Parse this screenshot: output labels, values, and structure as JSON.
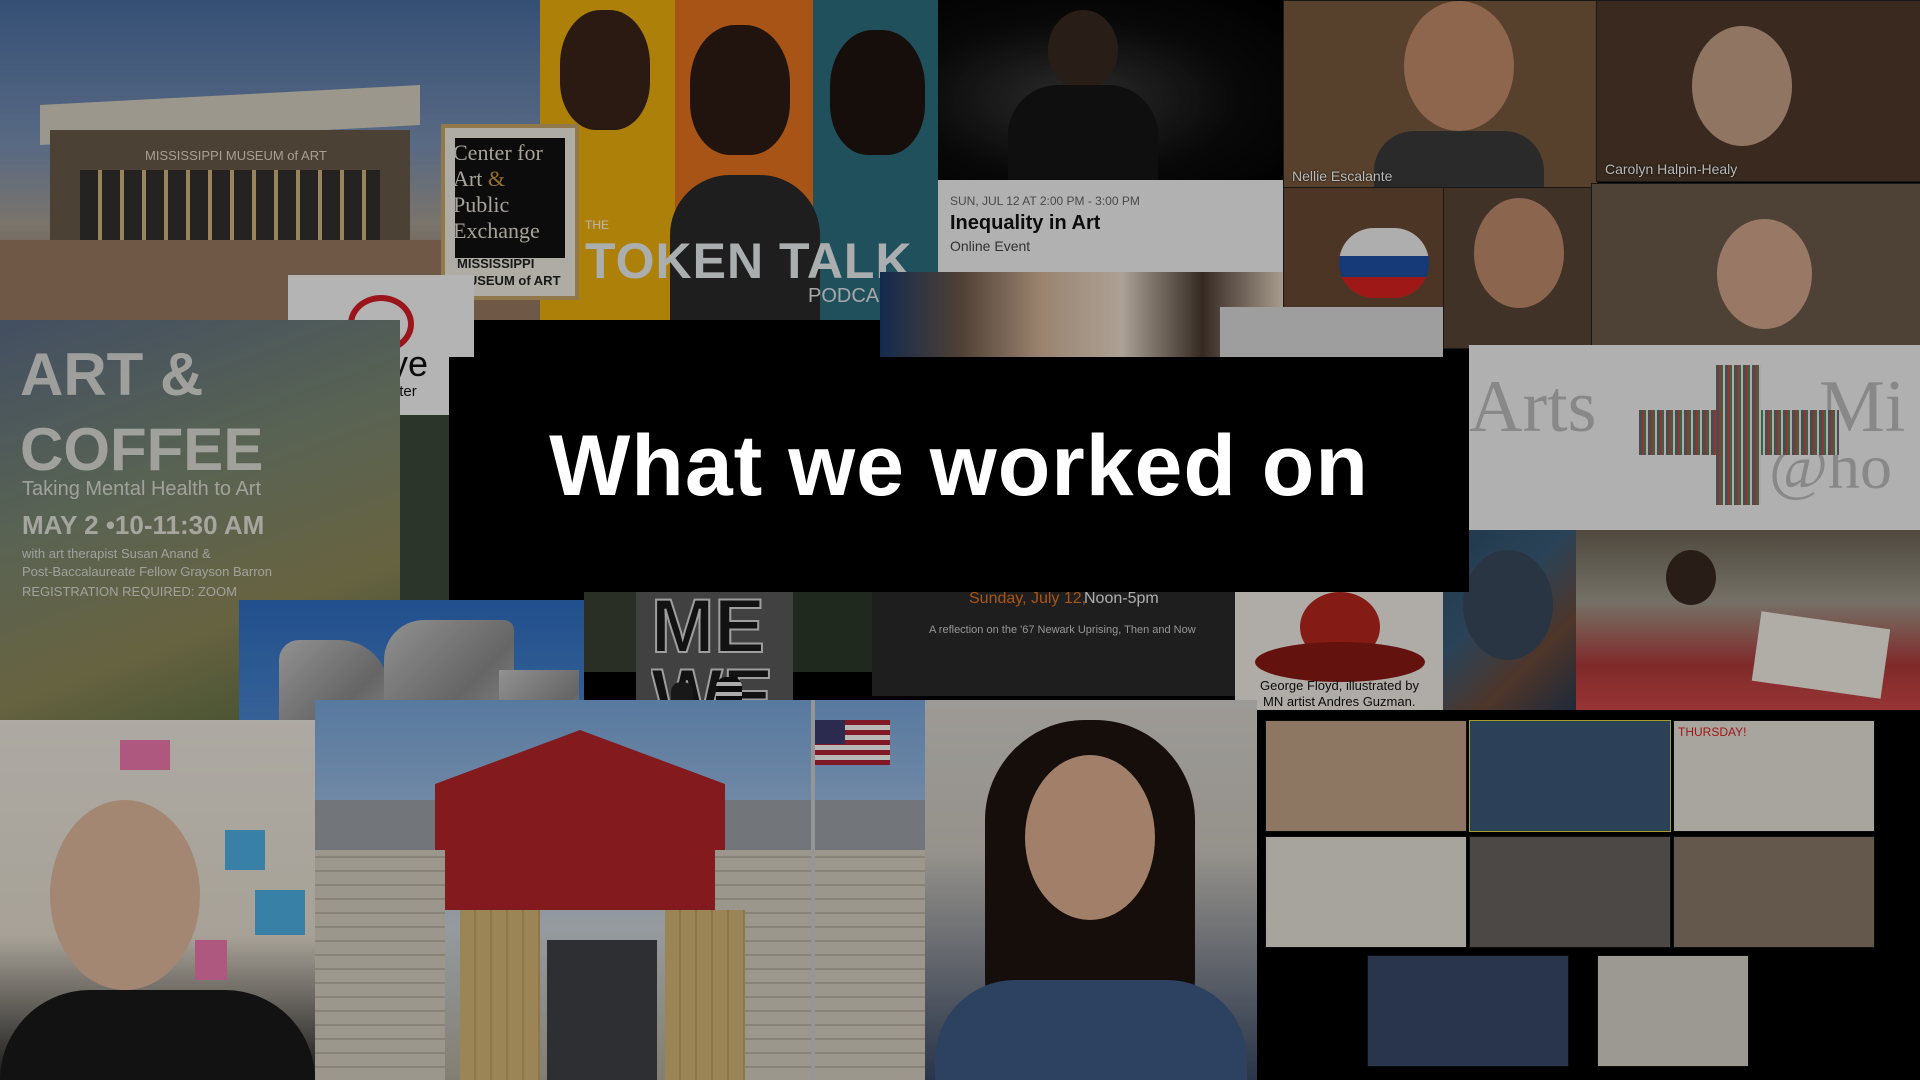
{
  "slide": {
    "title": "What we worked on"
  },
  "tiles": {
    "museum": {
      "sign": "MISSISSIPPI MUSEUM of ART"
    },
    "cape": {
      "lines": [
        "Center for",
        "Art",
        "&",
        "Public",
        "Exchange"
      ],
      "foot": [
        "MISSISSIPPI",
        "MUSEUM of ART"
      ]
    },
    "token_talk": {
      "small": "THE",
      "title": "TOKEN TALK",
      "podcast": "PODCA"
    },
    "event": {
      "date": "SUN, JUL 12 AT 2:00 PM - 3:00 PM",
      "title": "Inequality in Art",
      "type": "Online Event"
    },
    "zoom": {
      "name_1": "Nellie Escalante",
      "name_2": "Carolyn Halpin-Healy"
    },
    "red_eye": {
      "name": "red eye",
      "sub": "theater"
    },
    "art_coffee": {
      "line_1": "ART &",
      "line_2": "COFFEE",
      "sub": "Taking Mental Health to Art",
      "date": "MAY 2 •10-11:30 AM",
      "with": "with art therapist Susan Anand &",
      "with_2": "Post-Baccalaureate Fellow Grayson Barron",
      "reg": "REGISTRATION REQUIRED: ZOOM"
    },
    "arts_mix": {
      "left": "Arts",
      "right": "Mi",
      "bottom": "@ho"
    },
    "newark": {
      "date": "Sunday, July 12,",
      "time": "Noon-5pm",
      "sub": "A reflection on the '67 Newark Uprising, Then and Now"
    },
    "painting": {
      "caption_1": "George Floyd, illustrated by",
      "caption_2": "MN artist Andres Guzman."
    },
    "mewe": {
      "line_1": "ME",
      "line_2": "WE"
    },
    "classroom": {
      "note": "THURSDAY!"
    }
  },
  "colors": {
    "background": "#000000",
    "title_panel": "#000000",
    "title_text": "#ffffff",
    "accent_orange": "#e87522",
    "red_eye": "#d71e28"
  }
}
